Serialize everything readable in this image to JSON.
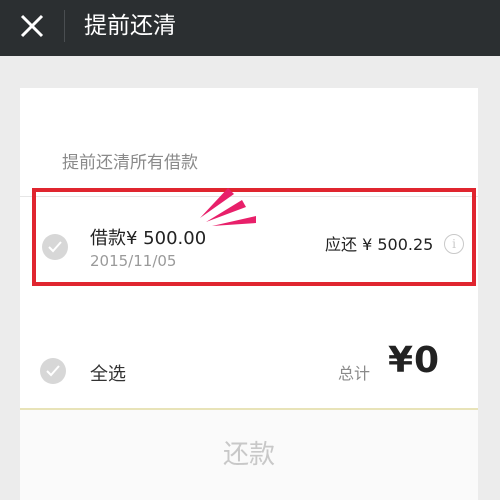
{
  "header": {
    "title": "提前还清",
    "close_icon": "close-icon"
  },
  "section": {
    "title": "提前还清所有借款"
  },
  "loan": {
    "amount_label": "借款¥ 500.00",
    "date": "2015/11/05",
    "due_label": "应还 ¥ 500.25",
    "info_icon": "i"
  },
  "footer": {
    "select_all_label": "全选",
    "total_label": "总计",
    "total_value": "¥0",
    "repay_button": "还款"
  },
  "colors": {
    "header_bg": "#2b2f31",
    "highlight": "#e0252f",
    "spark": "#e8206a"
  }
}
